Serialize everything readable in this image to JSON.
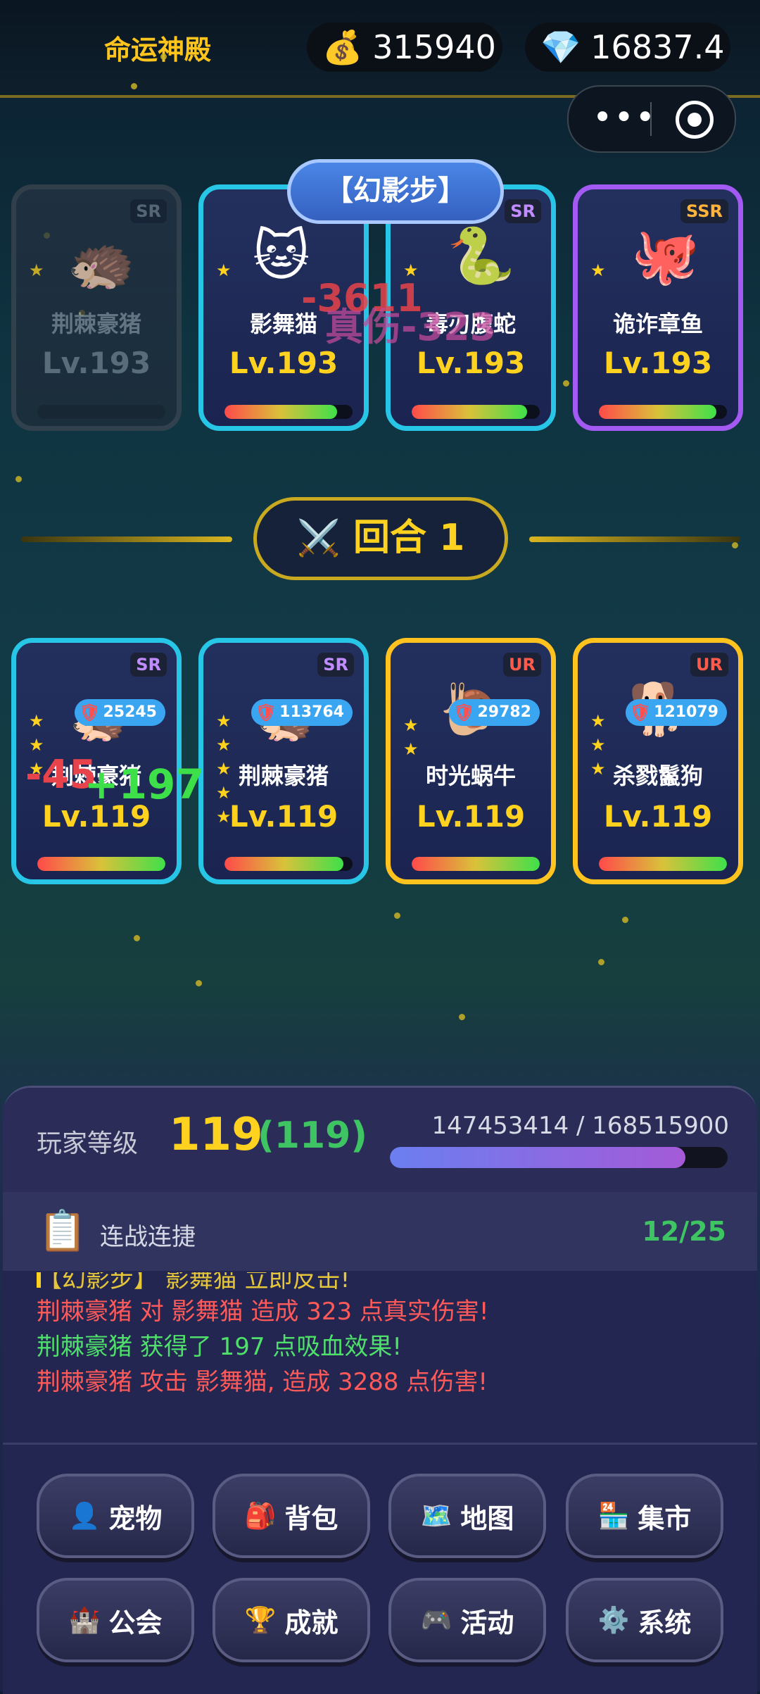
{
  "header": {
    "title": "命运神殿",
    "gold_icon": "💰",
    "gold": "315940",
    "gem_icon": "💎",
    "gems": "16837.4",
    "capsule_dots": "•••"
  },
  "skill_banner": "【幻影步】",
  "enemies": [
    {
      "rarity": "SR",
      "avatar": "🦔",
      "name": "荆棘豪猪",
      "level": "Lv.193",
      "stars": "★",
      "hp": 0,
      "state": "dead"
    },
    {
      "rarity": "SR",
      "avatar": "🐱",
      "name": "影舞猫",
      "level": "Lv.193",
      "stars": "★",
      "hp": 0.88
    },
    {
      "rarity": "SR",
      "avatar": "🐍",
      "name": "毒刃腹蛇",
      "level": "Lv.193",
      "stars": "★",
      "hp": 0.9
    },
    {
      "rarity": "SSR",
      "avatar": "🐙",
      "name": "诡诈章鱼",
      "level": "Lv.193",
      "stars": "★",
      "hp": 0.92
    }
  ],
  "enemy_damage": [
    "-3611",
    "真伤-323"
  ],
  "round": {
    "icon": "⚔️",
    "label": "回合 1"
  },
  "allies": [
    {
      "rarity": "SR",
      "avatar": "🦔",
      "name": "荆棘豪猪",
      "level": "Lv.119",
      "stars": [
        "★",
        "★",
        "★"
      ],
      "shield": "25245",
      "hp": 1.0
    },
    {
      "rarity": "SR",
      "avatar": "🦔",
      "name": "荆棘豪猪",
      "level": "Lv.119",
      "stars": [
        "★",
        "★",
        "★",
        "★",
        "★"
      ],
      "shield": "113764",
      "hp": 0.93
    },
    {
      "rarity": "UR",
      "avatar": "🐌",
      "name": "时光蜗牛",
      "level": "Lv.119",
      "stars": [
        "★",
        "★"
      ],
      "shield": "29782",
      "hp": 1.0
    },
    {
      "rarity": "UR",
      "avatar": "🐕",
      "name": "杀戮鬣狗",
      "level": "Lv.119",
      "stars": [
        "★",
        "★",
        "★"
      ],
      "shield": "121079",
      "hp": 1.0
    }
  ],
  "ally_popups": [
    "-45",
    "+197"
  ],
  "player": {
    "level_label": "玩家等级",
    "level": "119",
    "level_sub": "(119)",
    "exp_text": "147453414 / 168515900",
    "exp_fraction": 0.875
  },
  "streak": {
    "icon": "📋",
    "label": "连战连捷",
    "count": "12/25"
  },
  "log": {
    "partial": "【幻影步】 影舞猫 立即反击!",
    "lines": [
      {
        "text": "荆棘豪猪 对 影舞猫 造成 323 点真实伤害!",
        "color": "#ff5a5a"
      },
      {
        "text": "荆棘豪猪 获得了 197 点吸血效果!",
        "color": "#4ee06a"
      },
      {
        "text": "荆棘豪猪 攻击 影舞猫, 造成 3288 点伤害!",
        "color": "#ff5a5a"
      }
    ]
  },
  "menu": [
    {
      "icon": "👤",
      "label": "宠物"
    },
    {
      "icon": "🎒",
      "label": "背包"
    },
    {
      "icon": "🗺️",
      "label": "地图"
    },
    {
      "icon": "🏪",
      "label": "集市"
    },
    {
      "icon": "🏰",
      "label": "公会"
    },
    {
      "icon": "🏆",
      "label": "成就"
    },
    {
      "icon": "🎮",
      "label": "活动"
    },
    {
      "icon": "⚙️",
      "label": "系统"
    }
  ]
}
